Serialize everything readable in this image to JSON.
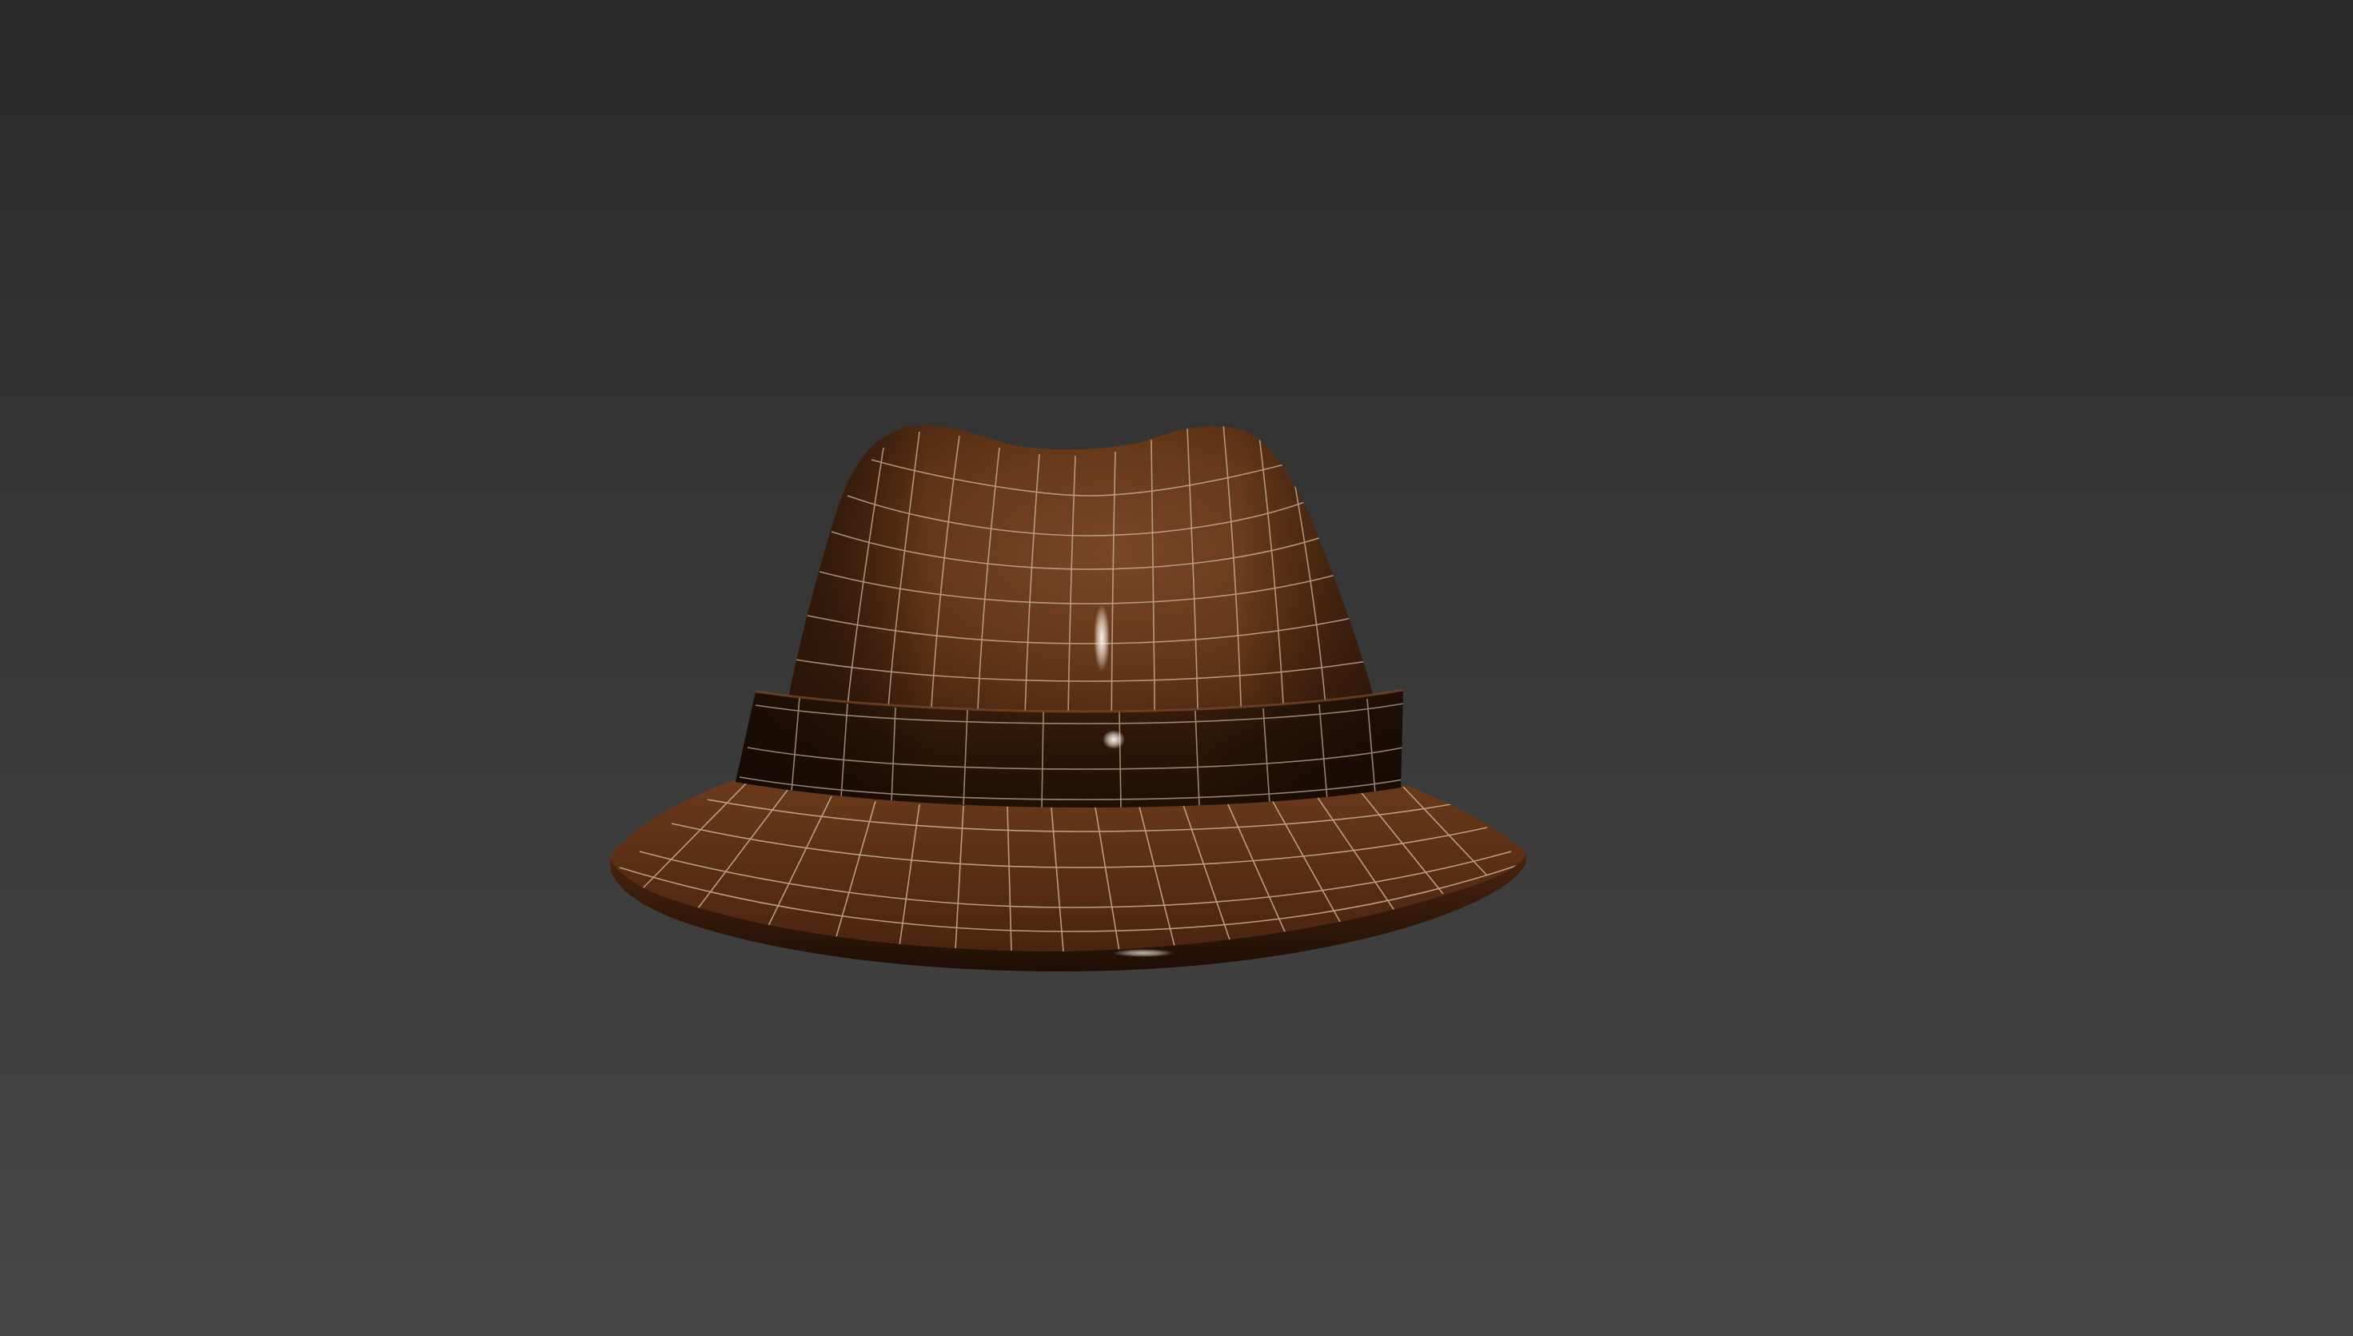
{
  "viewport": {
    "background_top": "#2a2a2a",
    "background_bottom": "#474747"
  },
  "model": {
    "object": "fedora-hat-mesh",
    "display_mode": "smooth-shaded-with-wireframe",
    "colors": {
      "crown": "#6a3a1f",
      "crown_shadow": "#3e1f0e",
      "band": "#2e170a",
      "brim": "#5a2f17",
      "wireframe": "#d9c2a8",
      "specular": "#ffffff"
    }
  }
}
